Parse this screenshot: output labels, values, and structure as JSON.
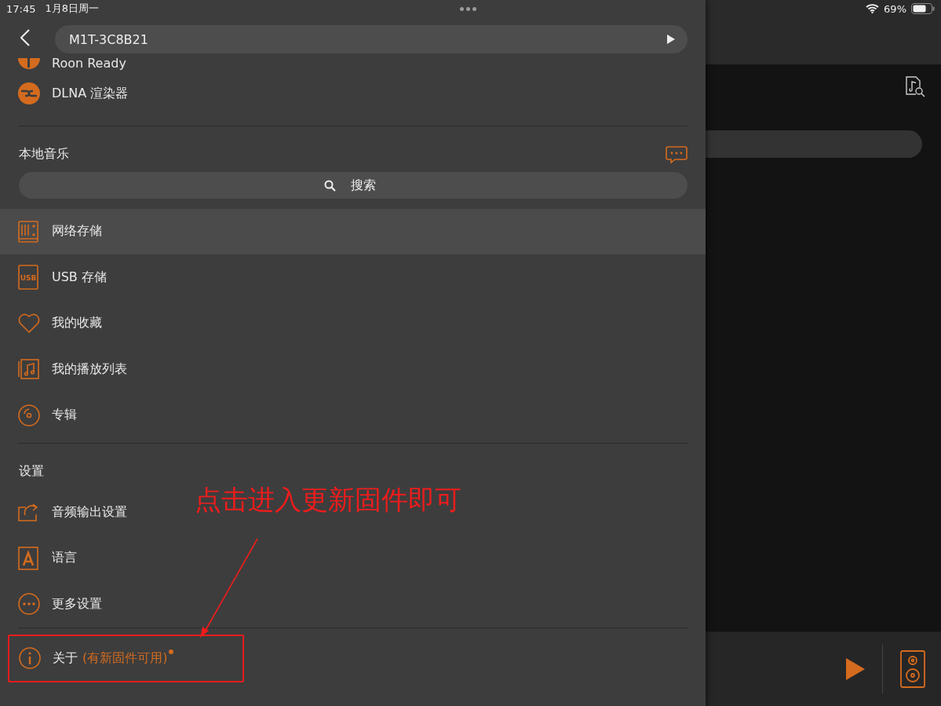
{
  "status_bar": {
    "time": "17:45",
    "date": "1月8日周一",
    "battery": "69%"
  },
  "drawer": {
    "device_name": "M1T-3C8B21",
    "renderers": [
      {
        "kind": "roon",
        "label": "Roon Ready"
      },
      {
        "kind": "dlna",
        "label": "DLNA 渲染器"
      }
    ],
    "local_music": {
      "title": "本地音乐",
      "search_placeholder": "搜索",
      "items": [
        {
          "kind": "nas",
          "label": "网络存储",
          "selected": true
        },
        {
          "kind": "drive",
          "icon_text": "USB",
          "label": "USB 存储",
          "selected": false
        },
        {
          "kind": "heart",
          "label": "我的收藏",
          "selected": false
        },
        {
          "kind": "playlist",
          "label": "我的播放列表",
          "selected": false
        },
        {
          "kind": "disc",
          "label": "专辑",
          "selected": false
        }
      ]
    },
    "settings": {
      "title": "设置",
      "items": [
        {
          "kind": "output",
          "label": "音频输出设置"
        },
        {
          "kind": "language",
          "label": "语言"
        },
        {
          "kind": "more",
          "label": "更多设置"
        }
      ]
    },
    "about": {
      "label": "关于",
      "notice": "(有新固件可用)",
      "badge_dot": true
    }
  },
  "annotation": {
    "text": "点击进入更新固件即可"
  }
}
